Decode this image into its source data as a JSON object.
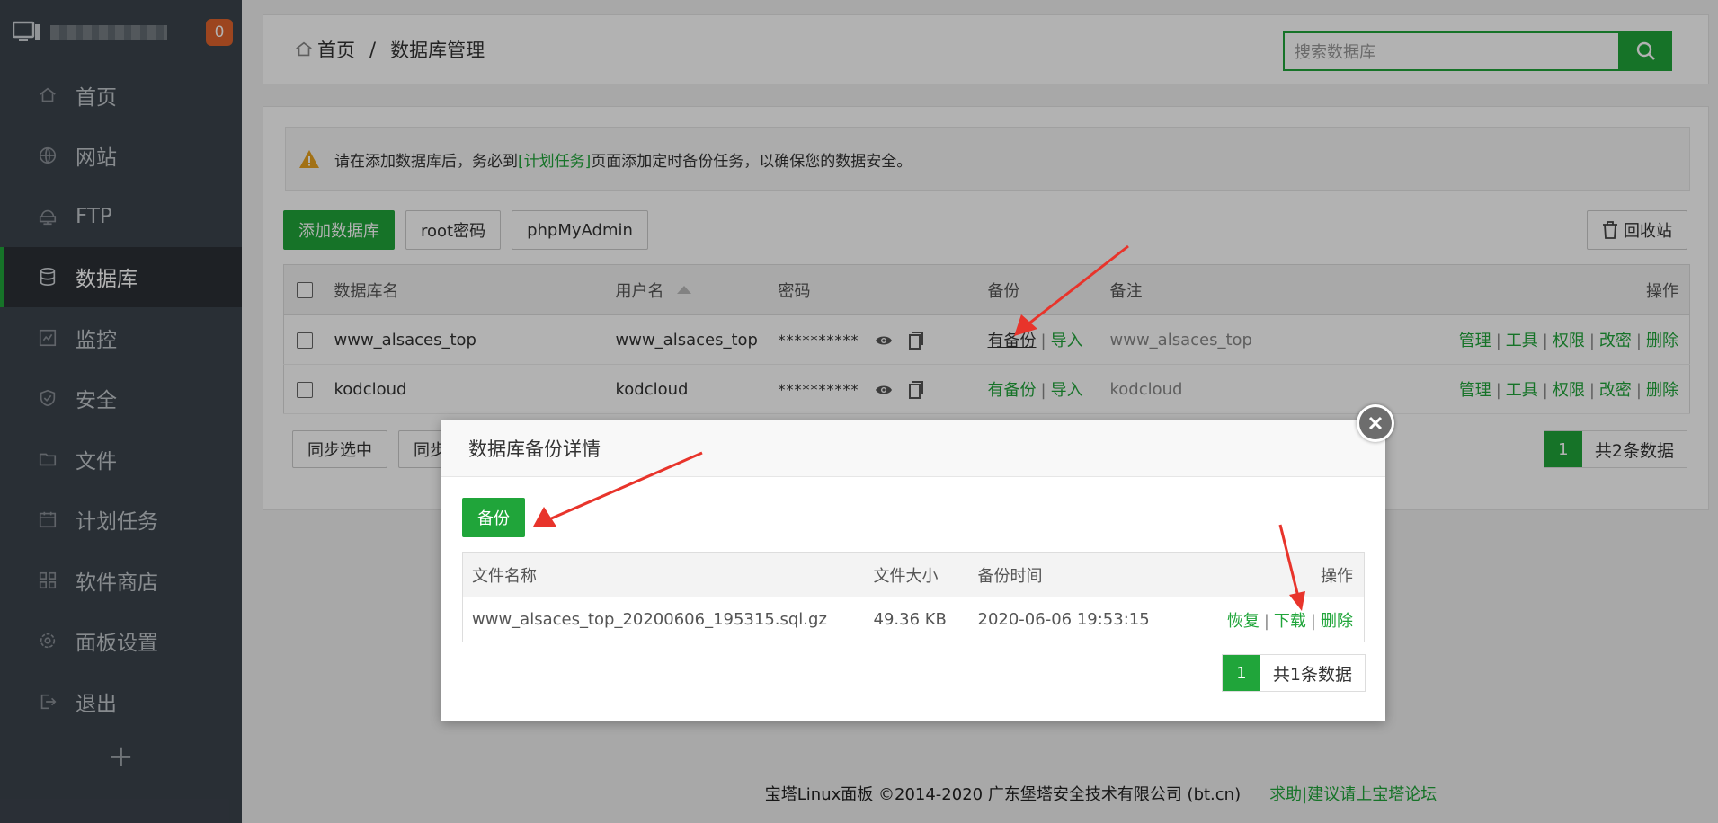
{
  "sidebar": {
    "badge": "0",
    "items": [
      {
        "label": "首页",
        "icon": "home-icon"
      },
      {
        "label": "网站",
        "icon": "globe-icon"
      },
      {
        "label": "FTP",
        "icon": "ftp-icon"
      },
      {
        "label": "数据库",
        "icon": "database-icon"
      },
      {
        "label": "监控",
        "icon": "monitor-icon"
      },
      {
        "label": "安全",
        "icon": "shield-icon"
      },
      {
        "label": "文件",
        "icon": "folder-icon"
      },
      {
        "label": "计划任务",
        "icon": "calendar-icon"
      },
      {
        "label": "软件商店",
        "icon": "grid-icon"
      },
      {
        "label": "面板设置",
        "icon": "gear-icon"
      },
      {
        "label": "退出",
        "icon": "logout-icon"
      }
    ],
    "active_index": 3,
    "add_label": "+"
  },
  "breadcrumb": {
    "home": "首页",
    "separator": "/",
    "current": "数据库管理"
  },
  "search": {
    "placeholder": "搜索数据库"
  },
  "alert": {
    "before": "请在添加数据库后，务必到",
    "link": "[计划任务]",
    "after": "页面添加定时备份任务，以确保您的数据安全。"
  },
  "toolbar": {
    "add_db": "添加数据库",
    "root_pw": "root密码",
    "phpmyadmin": "phpMyAdmin",
    "recycle": "回收站"
  },
  "table": {
    "headers": {
      "name": "数据库名",
      "user": "用户名",
      "password": "密码",
      "backup": "备份",
      "note": "备注",
      "ops": "操作"
    },
    "rows": [
      {
        "name": "www_alsaces_top",
        "user": "www_alsaces_top",
        "password": "**********",
        "backup": "有备份",
        "import": "导入",
        "note": "www_alsaces_top"
      },
      {
        "name": "kodcloud",
        "user": "kodcloud",
        "password": "**********",
        "backup": "有备份",
        "import": "导入",
        "note": "kodcloud"
      }
    ],
    "ops": {
      "manage": "管理",
      "tools": "工具",
      "perm": "权限",
      "change_pw": "改密",
      "delete": "删除"
    },
    "sep": "|"
  },
  "bottom": {
    "sync_selected": "同步选中",
    "sync_all": "同步",
    "page": "1",
    "total": "共2条数据"
  },
  "footer": {
    "copyright": "宝塔Linux面板 ©2014-2020 广东堡塔安全技术有限公司 (bt.cn)",
    "help": "求助|建议请上宝塔论坛"
  },
  "modal": {
    "title": "数据库备份详情",
    "backup_btn": "备份",
    "headers": {
      "file": "文件名称",
      "size": "文件大小",
      "time": "备份时间",
      "ops": "操作"
    },
    "rows": [
      {
        "file": "www_alsaces_top_20200606_195315.sql.gz",
        "size": "49.36 KB",
        "time": "2020-06-06 19:53:15",
        "restore": "恢复",
        "download": "下载",
        "delete": "删除"
      }
    ],
    "page": "1",
    "total": "共1条数据"
  },
  "colors": {
    "accent": "#20a53a",
    "sidebar": "#3c444d",
    "badge": "#e0642d",
    "arrow": "#e8342b"
  }
}
